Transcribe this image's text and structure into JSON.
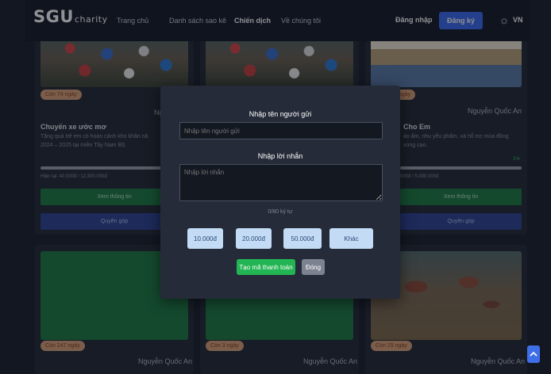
{
  "header": {
    "logo_main": "SGU",
    "logo_sub": "charity",
    "nav": [
      "Trang chủ",
      "Danh sách sao kê",
      "Chiến dịch",
      "Về chúng tôi"
    ],
    "login": "Đăng nhập",
    "register": "Đăng ký",
    "lang": "VN"
  },
  "cards_top": [
    {
      "badge": "Còn 74 ngày",
      "author": "Nguyễn",
      "title": "Chuyến xe ước mơ",
      "desc_line1": "Tặng quà trẻ em có hoàn cảnh khó khăn nă",
      "desc_line2": "2024 – 2025 tại miền Tây Nam Bộ.",
      "progress_text": "Hiện tại: 40.000đ / 12.300.000đ",
      "info_btn": "Xem thông tin",
      "donate_btn": "Quyên góp"
    },
    {
      "badge": "ngày",
      "author": "Nguyễn Quốc An",
      "title": "Cho Em",
      "desc_line1": "áo ấm, nhu yếu phẩm, và hỗ trợ mùa đông",
      "desc_line2": "vùng cao.",
      "progress_text": "000đ / 5.000.000đ",
      "pct": "1%",
      "info_btn": "Xem thông tin",
      "donate_btn": "Quyên góp"
    }
  ],
  "cards_bottom": [
    {
      "badge": "Còn 247 ngày",
      "author": "Nguyễn Quốc An"
    },
    {
      "badge": "Còn 3 ngày",
      "author": "Nguyễn Quốc An"
    },
    {
      "badge": "Còn 29 ngày",
      "author": "Nguyễn Quốc An"
    }
  ],
  "modal": {
    "sender_label": "Nhập tên người gửi",
    "sender_placeholder": "Nhập tên người gửi",
    "message_label": "Nhập lời nhắn",
    "message_placeholder": "Nhập lời nhắn",
    "counter": "0/80 ký tự",
    "amounts": [
      "10.000đ",
      "20.000đ",
      "50.000đ",
      "Khác"
    ],
    "create_btn": "Tạo mã thanh toán",
    "close_btn": "Đóng"
  },
  "colors": {
    "background": "#1c2230",
    "primary": "#3b6bf0",
    "success": "#23b553",
    "amount_btn": "#c3dbf4"
  }
}
